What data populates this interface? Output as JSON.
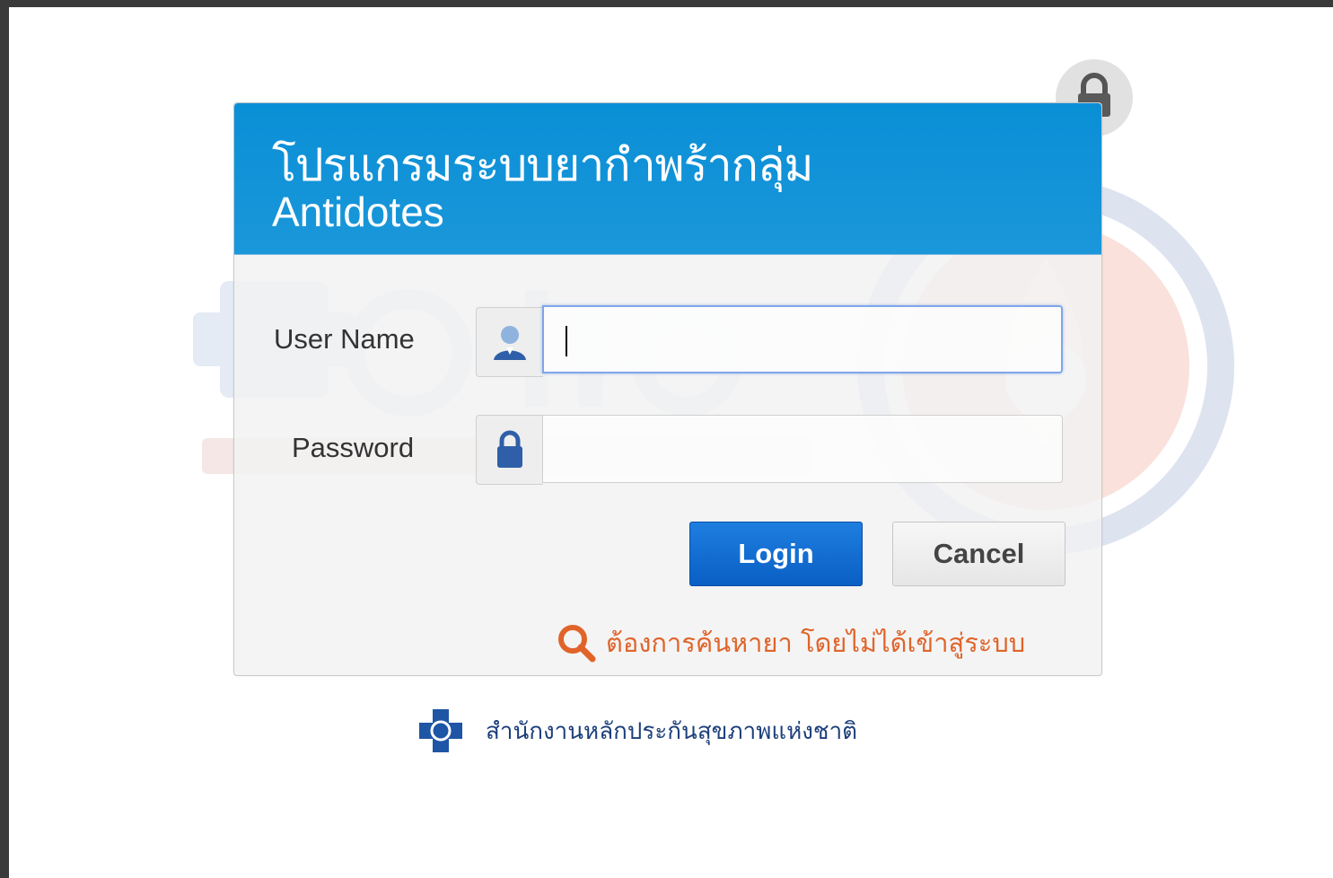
{
  "header": {
    "title_th": "โปรแกรมระบบยากำพร้ากลุ่ม",
    "title_en": "Antidotes"
  },
  "form": {
    "username_label": "User Name",
    "username_value": "",
    "password_label": "Password",
    "password_value": "",
    "user_icon": "user-icon",
    "password_icon": "lock-icon"
  },
  "buttons": {
    "login": "Login",
    "cancel": "Cancel"
  },
  "search_link": {
    "icon": "search-icon",
    "label": "ต้องการค้นหายา โดยไม่ได้เข้าสู่ระบบ"
  },
  "footer": {
    "logo": "nhso-logo",
    "org_name": "สำนักงานหลักประกันสุขภาพแห่งชาติ"
  },
  "colors": {
    "header_blue": "#0a8fd6",
    "login_blue": "#0a5fc4",
    "link_orange": "#e0642a",
    "footer_navy": "#1d3f7a"
  }
}
